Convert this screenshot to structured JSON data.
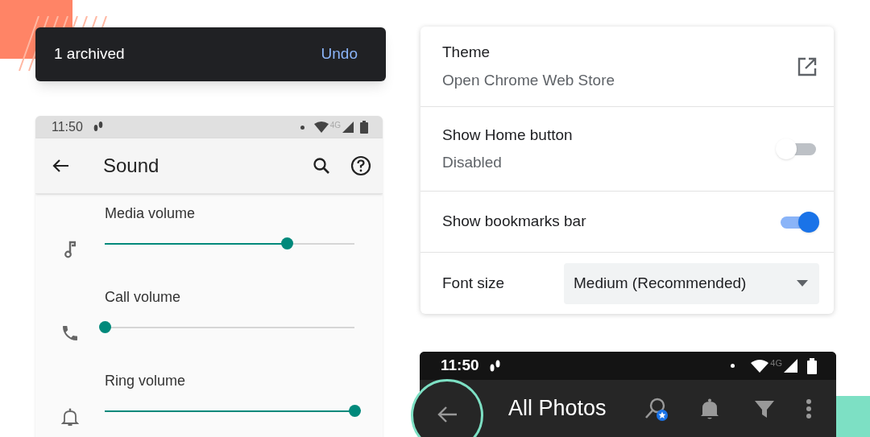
{
  "snackbar": {
    "message": "1 archived",
    "action": "Undo"
  },
  "sound_screen": {
    "status_bar": {
      "time": "11:50",
      "network": "4G"
    },
    "title": "Sound",
    "sliders": [
      {
        "label": "Media volume",
        "level": 0.73
      },
      {
        "label": "Call volume",
        "level": 0
      },
      {
        "label": "Ring volume",
        "level": 1
      }
    ]
  },
  "chrome_settings": {
    "rows": [
      {
        "kind": "link",
        "title": "Theme",
        "subtitle": "Open Chrome Web Store"
      },
      {
        "kind": "toggle",
        "title": "Show Home button",
        "subtitle": "Disabled",
        "on": false
      },
      {
        "kind": "toggle",
        "title": "Show bookmarks bar",
        "on": true
      },
      {
        "kind": "select",
        "title": "Font size",
        "value": "Medium (Recommended)"
      }
    ]
  },
  "photos_screen": {
    "status_bar": {
      "time": "11:50",
      "network": "4G"
    },
    "title": "All Photos"
  }
}
